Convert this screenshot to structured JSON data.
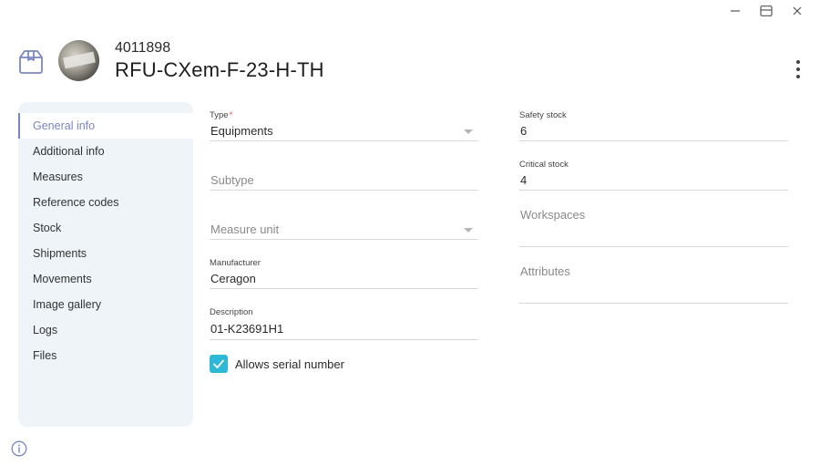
{
  "header": {
    "code": "4011898",
    "title": "RFU-CXem-F-23-H-TH"
  },
  "sidebar": {
    "items": [
      {
        "label": "General info",
        "active": true
      },
      {
        "label": "Additional info"
      },
      {
        "label": "Measures"
      },
      {
        "label": "Reference codes"
      },
      {
        "label": "Stock"
      },
      {
        "label": "Shipments"
      },
      {
        "label": "Movements"
      },
      {
        "label": "Image gallery"
      },
      {
        "label": "Logs"
      },
      {
        "label": "Files"
      }
    ]
  },
  "form": {
    "type": {
      "label": "Type",
      "required_mark": "*",
      "value": "Equipments"
    },
    "subtype": {
      "placeholder": "Subtype"
    },
    "measure_unit": {
      "placeholder": "Measure unit"
    },
    "manufacturer": {
      "label": "Manufacturer",
      "value": "Ceragon"
    },
    "description": {
      "label": "Description",
      "value": "01-K23691H1"
    },
    "allows_serial": {
      "label": "Allows serial number",
      "checked": true
    },
    "safety_stock": {
      "label": "Safety stock",
      "value": "6"
    },
    "critical_stock": {
      "label": "Critical stock",
      "value": "4"
    },
    "workspaces": {
      "placeholder": "Workspaces"
    },
    "attributes": {
      "placeholder": "Attributes"
    }
  },
  "colors": {
    "accent": "#7a86c2",
    "checkbox": "#2cb8d6",
    "sidebar_bg": "#eef4f7"
  },
  "icons": {
    "box": "package-icon",
    "info": "info-icon"
  }
}
